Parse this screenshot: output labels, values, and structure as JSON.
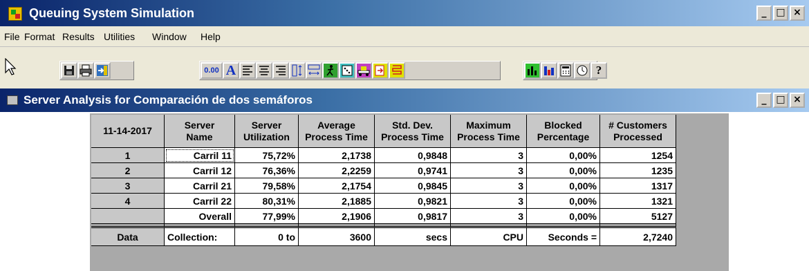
{
  "app": {
    "title": "Queuing System Simulation"
  },
  "menu": [
    "File",
    "Format",
    "Results",
    "Utilities",
    "Window",
    "Help"
  ],
  "toolbar": {
    "decimal_button": "0.00",
    "font_button": "A"
  },
  "window": {
    "title": "Server Analysis for Comparación de dos semáforos"
  },
  "table": {
    "date": "11-14-2017",
    "headers": [
      [
        "Server",
        "Name"
      ],
      [
        "Server",
        "Utilization"
      ],
      [
        "Average",
        "Process Time"
      ],
      [
        "Std. Dev.",
        "Process Time"
      ],
      [
        "Maximum",
        "Process Time"
      ],
      [
        "Blocked",
        "Percentage"
      ],
      [
        "# Customers",
        "Processed"
      ]
    ],
    "rows": [
      {
        "id": "1",
        "cells": [
          "Carril 11",
          "75,72%",
          "2,1738",
          "0,9848",
          "3",
          "0,00%",
          "1254"
        ]
      },
      {
        "id": "2",
        "cells": [
          "Carril 12",
          "76,36%",
          "2,2259",
          "0,9741",
          "3",
          "0,00%",
          "1235"
        ]
      },
      {
        "id": "3",
        "cells": [
          "Carril 21",
          "79,58%",
          "2,1754",
          "0,9845",
          "3",
          "0,00%",
          "1317"
        ]
      },
      {
        "id": "4",
        "cells": [
          "Carril 22",
          "80,31%",
          "2,1885",
          "0,9821",
          "3",
          "0,00%",
          "1321"
        ]
      },
      {
        "id": "",
        "cells": [
          "Overall",
          "77,99%",
          "2,1906",
          "0,9817",
          "3",
          "0,00%",
          "5127"
        ]
      }
    ],
    "footer": {
      "label": "Data",
      "cells": [
        "Collection:",
        "0 to",
        "3600",
        "secs",
        "CPU",
        "Seconds =",
        "2,7240"
      ]
    }
  }
}
